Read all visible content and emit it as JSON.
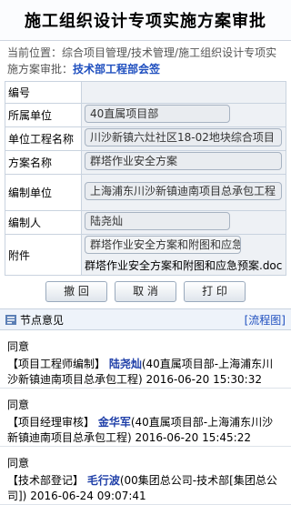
{
  "header": {
    "title": "施工组织设计专项实施方案审批"
  },
  "breadcrumb": {
    "prefix": "当前位置：综合项目管理/技术管理/施工组织设计专项实施方案审批：",
    "current": "技术部工程部会签"
  },
  "form": {
    "rows": [
      {
        "label": "编号",
        "value": ""
      },
      {
        "label": "所属单位",
        "value": "40直属项目部"
      },
      {
        "label": "单位工程名称",
        "value": "川沙新镇六灶社区18-02地块综合项目"
      },
      {
        "label": "方案名称",
        "value": "群塔作业安全方案"
      },
      {
        "label": "编制单位",
        "value": "上海浦东川沙新镇迪南项目总承包工程"
      },
      {
        "label": "编制人",
        "value": "陆尧灿"
      },
      {
        "label": "附件",
        "value": "群塔作业安全方案和附图和应急预案",
        "file": "群塔作业安全方案和附图和应急预案.doc"
      }
    ]
  },
  "buttons": {
    "cancel": "撤 回",
    "abort": "取 消",
    "print": "打 印"
  },
  "opinions": {
    "title": "节点意见",
    "flow_link": "[流程图]",
    "items": [
      {
        "status": "同意",
        "step": "【项目工程师编制】",
        "name": "陆尧灿",
        "detail": "(40直属项目部-上海浦东川沙新镇迪南项目总承包工程)",
        "time": "2016-06-20 15:30:32"
      },
      {
        "status": "同意",
        "step": "【项目经理审核】",
        "name": "金华军",
        "detail": "(40直属项目部-上海浦东川沙新镇迪南项目总承包工程)",
        "time": "2016-06-20 15:45:22"
      },
      {
        "status": "同意",
        "step": "【技术部登记】",
        "name": "毛行波",
        "detail": "(00集团总公司-技术部[集团总公司])",
        "time": "2016-06-24 09:07:41"
      }
    ]
  }
}
